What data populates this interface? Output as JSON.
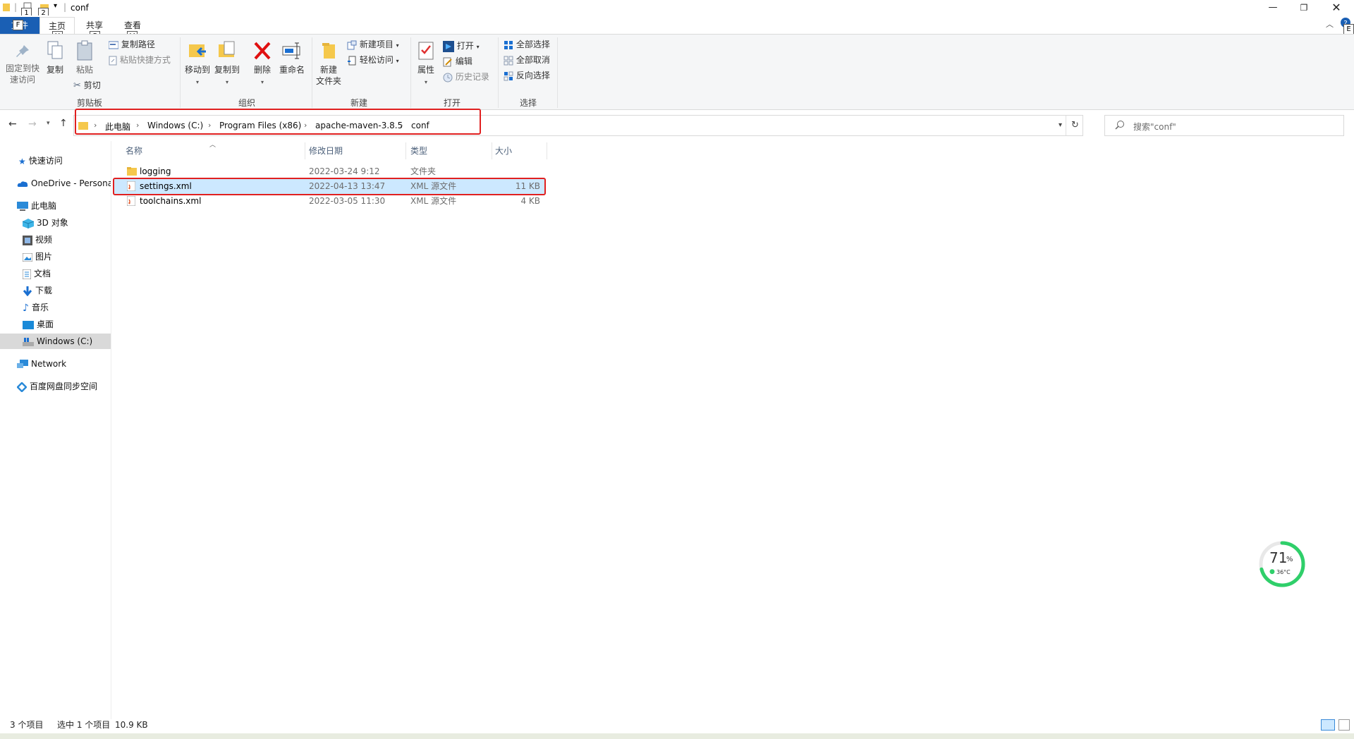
{
  "window": {
    "title": "conf"
  },
  "tabs": {
    "file": "文件",
    "home": "主页",
    "share": "共享",
    "view": "查看"
  },
  "keytips": {
    "k1": "1",
    "k2": "2",
    "file": "F",
    "home": "H",
    "share": "S",
    "view": "V",
    "help": "E"
  },
  "ribbon": {
    "clipboard": {
      "label": "剪贴板",
      "pin_line1": "固定到快",
      "pin_line2": "速访问",
      "copy": "复制",
      "paste": "粘贴",
      "copy_path": "复制路径",
      "paste_shortcut": "粘贴快捷方式",
      "cut": "剪切"
    },
    "organize": {
      "label": "组织",
      "move_to": "移动到",
      "copy_to": "复制到",
      "delete": "删除",
      "rename": "重命名"
    },
    "new": {
      "label": "新建",
      "new_folder_line1": "新建",
      "new_folder_line2": "文件夹",
      "new_item": "新建项目",
      "easy_access": "轻松访问"
    },
    "open": {
      "label": "打开",
      "properties": "属性",
      "open": "打开",
      "edit": "编辑",
      "history": "历史记录"
    },
    "select": {
      "label": "选择",
      "select_all": "全部选择",
      "select_none": "全部取消",
      "invert": "反向选择"
    }
  },
  "address": {
    "crumbs": [
      "此电脑",
      "Windows (C:)",
      "Program Files (x86)",
      "apache-maven-3.8.5",
      "conf"
    ],
    "search_placeholder": "搜索\"conf\""
  },
  "sidebar": {
    "items": [
      {
        "label": "快速访问"
      },
      {
        "label": "OneDrive - Personal"
      },
      {
        "label": "此电脑"
      },
      {
        "label": "3D 对象"
      },
      {
        "label": "视频"
      },
      {
        "label": "图片"
      },
      {
        "label": "文档"
      },
      {
        "label": "下载"
      },
      {
        "label": "音乐"
      },
      {
        "label": "桌面"
      },
      {
        "label": "Windows (C:)"
      },
      {
        "label": "Network"
      },
      {
        "label": "百度网盘同步空间"
      }
    ]
  },
  "columns": {
    "name": "名称",
    "modified": "修改日期",
    "type": "类型",
    "size": "大小"
  },
  "files": [
    {
      "name": "logging",
      "modified": "2022-03-24 9:12",
      "type": "文件夹",
      "size": ""
    },
    {
      "name": "settings.xml",
      "modified": "2022-04-13 13:47",
      "type": "XML 源文件",
      "size": "11 KB"
    },
    {
      "name": "toolchains.xml",
      "modified": "2022-03-05 11:30",
      "type": "XML 源文件",
      "size": "4 KB"
    }
  ],
  "status": {
    "count": "3 个项目",
    "selected": "选中 1 个项目",
    "selsize": "10.9 KB"
  },
  "widget": {
    "percent": "71",
    "percent_unit": "%",
    "temp": "36°C",
    "level": 0.71
  },
  "colors": {
    "accent": "#1a5fb4",
    "selection": "#cce8ff",
    "highlight_box": "#e02020",
    "gauge": "#2fcf6a"
  }
}
